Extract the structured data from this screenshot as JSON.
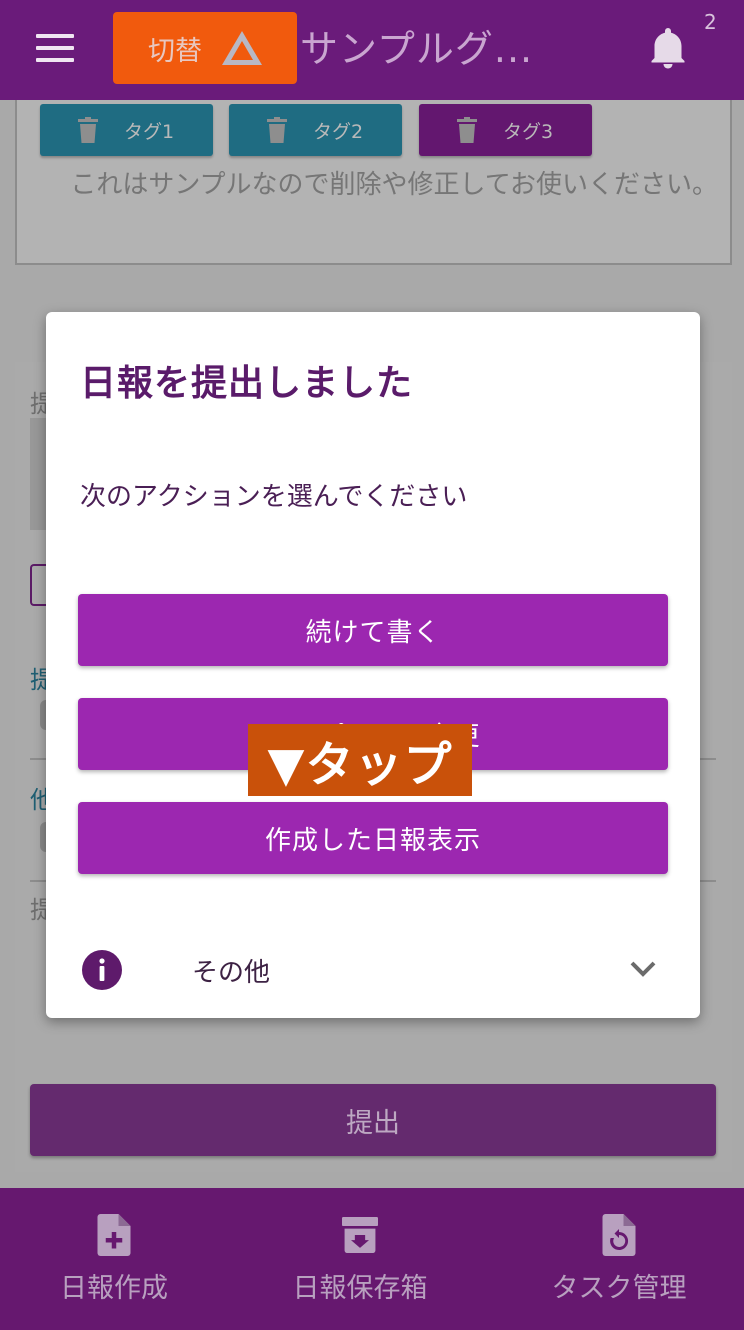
{
  "appbar": {
    "switch_label": "切替",
    "title": "サンプルグ...",
    "notification_count": "2"
  },
  "tags": [
    {
      "label": "タグ1",
      "color": "#1f6c82"
    },
    {
      "label": "タグ2",
      "color": "#1f6c82"
    },
    {
      "label": "タグ3",
      "color": "#63176f"
    }
  ],
  "sample_text": "これはサンプルなので削除や修正してお使いください。",
  "background_form": {
    "fragments": [
      "提",
      "提",
      "他",
      "提"
    ],
    "submit_label": "提出"
  },
  "dialog": {
    "title": "日報を提出しました",
    "message": "次のアクションを選んでください",
    "actions": [
      {
        "label": "続けて書く"
      },
      {
        "label": "テンプレート変更"
      },
      {
        "label": "作成した日報表示"
      }
    ],
    "other_label": "その他"
  },
  "annotation": {
    "text": "▼タップ",
    "color": "#c9510a"
  },
  "bottom_nav": [
    {
      "label": "日報作成",
      "icon": "file-plus-icon"
    },
    {
      "label": "日報保存箱",
      "icon": "archive-icon"
    },
    {
      "label": "タスク管理",
      "icon": "file-restore-icon"
    }
  ],
  "colors": {
    "primary": "#6a1b7a",
    "accent": "#9c27b0",
    "switch_button": "#f15a0d"
  }
}
